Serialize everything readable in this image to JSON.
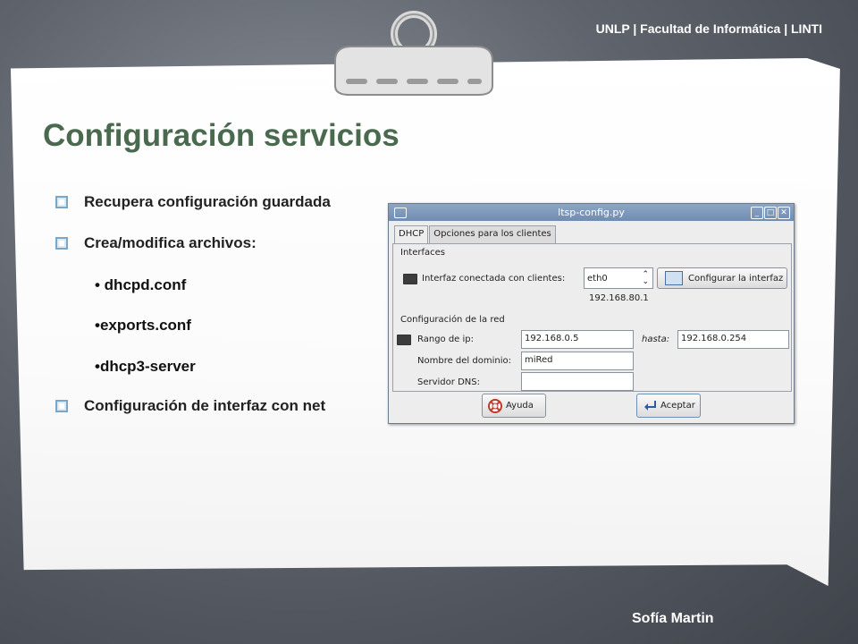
{
  "header": {
    "institution": "UNLP | Facultad de Informática | LINTI"
  },
  "slide": {
    "title": "Configuración servicios",
    "bullets": [
      "Recupera configuración guardada",
      "Crea/modifica archivos:",
      "Configuración de interfaz con net"
    ],
    "subitems": [
      "• dhcpd.conf",
      "•exports.conf",
      "•dhcp3-server"
    ],
    "author": "Sofía Martin"
  },
  "dialog": {
    "title": "ltsp-config.py",
    "titlebar_buttons": [
      "_",
      "□",
      "✕"
    ],
    "tabs": [
      "DHCP",
      "Opciones para los clientes"
    ],
    "sections": {
      "interfaces": "Interfaces",
      "network": "Configuración de la red"
    },
    "interface_label": "Interfaz conectada con clientes:",
    "interface_value": "eth0",
    "configure_button": "Configurar la interfaz",
    "ip_address": "192.168.80.1",
    "range_label": "Rango de ip:",
    "range_from": "192.168.0.5",
    "until_label": "hasta:",
    "range_to": "192.168.0.254",
    "domain_label": "Nombre del dominio:",
    "domain_value": "miRed",
    "dns_label": "Servidor DNS:",
    "dns_value": "",
    "help_button": "Ayuda",
    "accept_button": "Aceptar"
  },
  "colors": {
    "title_green": "#4a6a4f",
    "titlebar_blue": "#7f99bb",
    "bullet_blue": "#7aa7c7"
  }
}
